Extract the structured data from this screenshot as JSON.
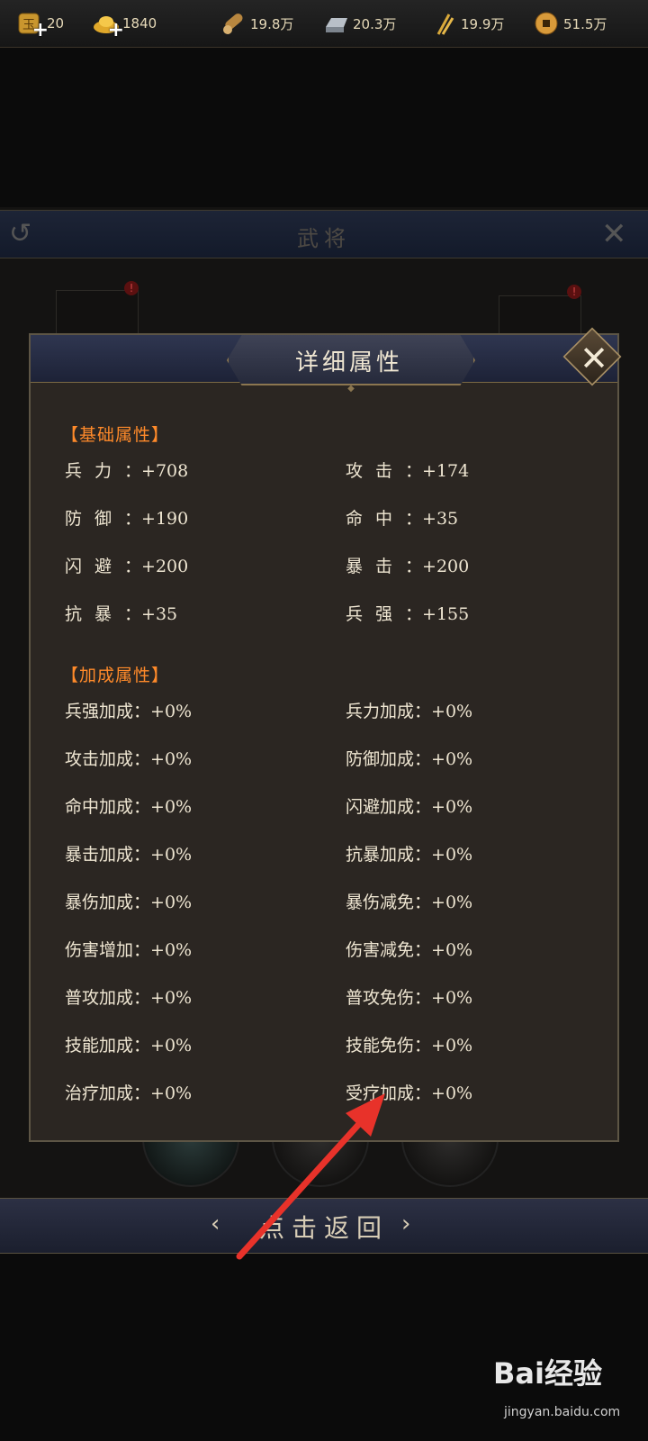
{
  "resources": [
    {
      "icon": "jade-token-icon",
      "value": "20",
      "has_plus": true
    },
    {
      "icon": "gold-ingot-icon",
      "value": "1840",
      "has_plus": true
    },
    {
      "icon": "wood-log-icon",
      "value": "19.8万"
    },
    {
      "icon": "iron-ingot-icon",
      "value": "20.3万"
    },
    {
      "icon": "grain-icon",
      "value": "19.9万"
    },
    {
      "icon": "copper-coin-icon",
      "value": "51.5万"
    }
  ],
  "background": {
    "title": "武将"
  },
  "modal": {
    "title": "详细属性",
    "basic_section": "【基础属性】",
    "basic": [
      {
        "key": "兵力",
        "value": "+708"
      },
      {
        "key": "攻击",
        "value": "+174"
      },
      {
        "key": "防御",
        "value": "+190"
      },
      {
        "key": "命中",
        "value": "+35"
      },
      {
        "key": "闪避",
        "value": "+200"
      },
      {
        "key": "暴击",
        "value": "+200"
      },
      {
        "key": "抗暴",
        "value": "+35"
      },
      {
        "key": "兵强",
        "value": "+155"
      }
    ],
    "bonus_section": "【加成属性】",
    "bonus": [
      {
        "key": "兵强加成",
        "value": "+0%"
      },
      {
        "key": "兵力加成",
        "value": "+0%"
      },
      {
        "key": "攻击加成",
        "value": "+0%"
      },
      {
        "key": "防御加成",
        "value": "+0%"
      },
      {
        "key": "命中加成",
        "value": "+0%"
      },
      {
        "key": "闪避加成",
        "value": "+0%"
      },
      {
        "key": "暴击加成",
        "value": "+0%"
      },
      {
        "key": "抗暴加成",
        "value": "+0%"
      },
      {
        "key": "暴伤加成",
        "value": "+0%"
      },
      {
        "key": "暴伤减免",
        "value": "+0%"
      },
      {
        "key": "伤害增加",
        "value": "+0%"
      },
      {
        "key": "伤害减免",
        "value": "+0%"
      },
      {
        "key": "普攻加成",
        "value": "+0%"
      },
      {
        "key": "普攻免伤",
        "value": "+0%"
      },
      {
        "key": "技能加成",
        "value": "+0%"
      },
      {
        "key": "技能免伤",
        "value": "+0%"
      },
      {
        "key": "治疗加成",
        "value": "+0%"
      },
      {
        "key": "受疗加成",
        "value": "+0%"
      }
    ]
  },
  "return_label": "点击返回",
  "watermark": {
    "brand": "Bai经验",
    "url": "jingyan.baidu.com"
  },
  "colors": {
    "section": "#ff8a2a",
    "text": "#efe6d2",
    "arrow": "#e8322a",
    "accent_border": "#8b7650"
  }
}
